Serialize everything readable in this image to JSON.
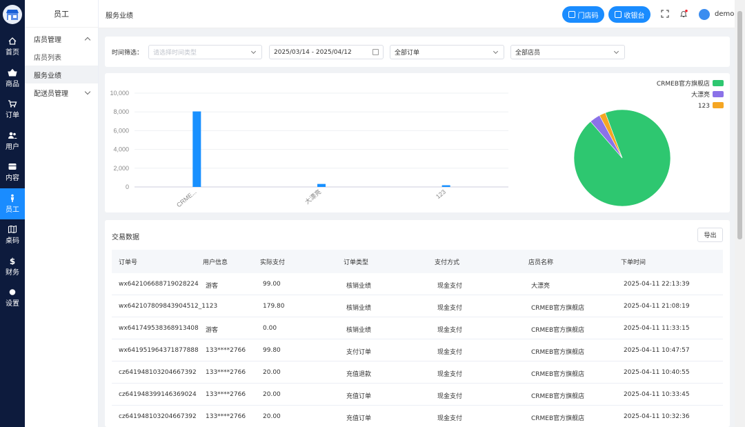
{
  "rail": {
    "items": [
      {
        "label": "首页",
        "icon": "home-icon"
      },
      {
        "label": "商品",
        "icon": "basket-icon"
      },
      {
        "label": "订单",
        "icon": "cart-icon"
      },
      {
        "label": "用户",
        "icon": "users-icon"
      },
      {
        "label": "内容",
        "icon": "content-icon"
      },
      {
        "label": "员工",
        "icon": "staff-icon",
        "active": true
      },
      {
        "label": "桌码",
        "icon": "table-code-icon"
      },
      {
        "label": "财务",
        "icon": "dollar-icon"
      },
      {
        "label": "设置",
        "icon": "settings-icon"
      }
    ]
  },
  "subnav": {
    "title": "员工",
    "group1": "店员管理",
    "item1": "店员列表",
    "item2": "服务业绩",
    "group2": "配送员管理"
  },
  "topbar": {
    "breadcrumb": "服务业绩",
    "store_code_btn": "门店码",
    "cashier_btn": "收银台",
    "username": "demo"
  },
  "filters": {
    "label": "时间筛选：",
    "time_type_placeholder": "请选择时间类型",
    "date_range": "2025/03/14 - 2025/04/12",
    "order_select": "全部订单",
    "store_select": "全部店员"
  },
  "chart_data": [
    {
      "type": "bar",
      "categories": [
        "CRME...",
        "大漂亮",
        "123"
      ],
      "values": [
        8050,
        320,
        180
      ],
      "ylim": [
        0,
        10000
      ],
      "yticks": [
        "10,000",
        "8,000",
        "6,000",
        "4,000",
        "2,000",
        "0"
      ],
      "grid": true,
      "color": "#1890ff"
    },
    {
      "type": "pie",
      "labels": [
        "CRMEB官方旗舰店",
        "大漂亮",
        "123"
      ],
      "values": [
        94.3,
        3.6,
        2.1
      ],
      "colors": [
        "#2ec770",
        "#8b72e8",
        "#f5a623"
      ],
      "legend": "top-right"
    }
  ],
  "table": {
    "title": "交易数据",
    "export": "导出",
    "headers": [
      "订单号",
      "用户信息",
      "实际支付",
      "订单类型",
      "支付方式",
      "店员名称",
      "下单时间"
    ],
    "rows": [
      [
        "wx642106688719028224",
        "游客",
        "99.00",
        "核销业绩",
        "现金支付",
        "大漂亮",
        "2025-04-11 22:13:39"
      ],
      [
        "wx642107809843904512_1",
        "123",
        "179.80",
        "核销业绩",
        "现金支付",
        "CRMEB官方旗舰店",
        "2025-04-11 21:08:19"
      ],
      [
        "wx641749538368913408",
        "游客",
        "0.00",
        "核销业绩",
        "现金支付",
        "CRMEB官方旗舰店",
        "2025-04-11 11:33:15"
      ],
      [
        "wx641951964371877888",
        "133****2766",
        "99.80",
        "支付订单",
        "现金支付",
        "CRMEB官方旗舰店",
        "2025-04-11 10:47:57"
      ],
      [
        "cz641948103204667392",
        "133****2766",
        "20.00",
        "充值退款",
        "现金支付",
        "CRMEB官方旗舰店",
        "2025-04-11 10:40:55"
      ],
      [
        "cz641948399146369024",
        "133****2766",
        "20.00",
        "充值订单",
        "现金支付",
        "CRMEB官方旗舰店",
        "2025-04-11 10:33:45"
      ],
      [
        "cz641948103204667392",
        "133****2766",
        "20.00",
        "充值订单",
        "现金支付",
        "CRMEB官方旗舰店",
        "2025-04-11 10:32:36"
      ]
    ]
  }
}
